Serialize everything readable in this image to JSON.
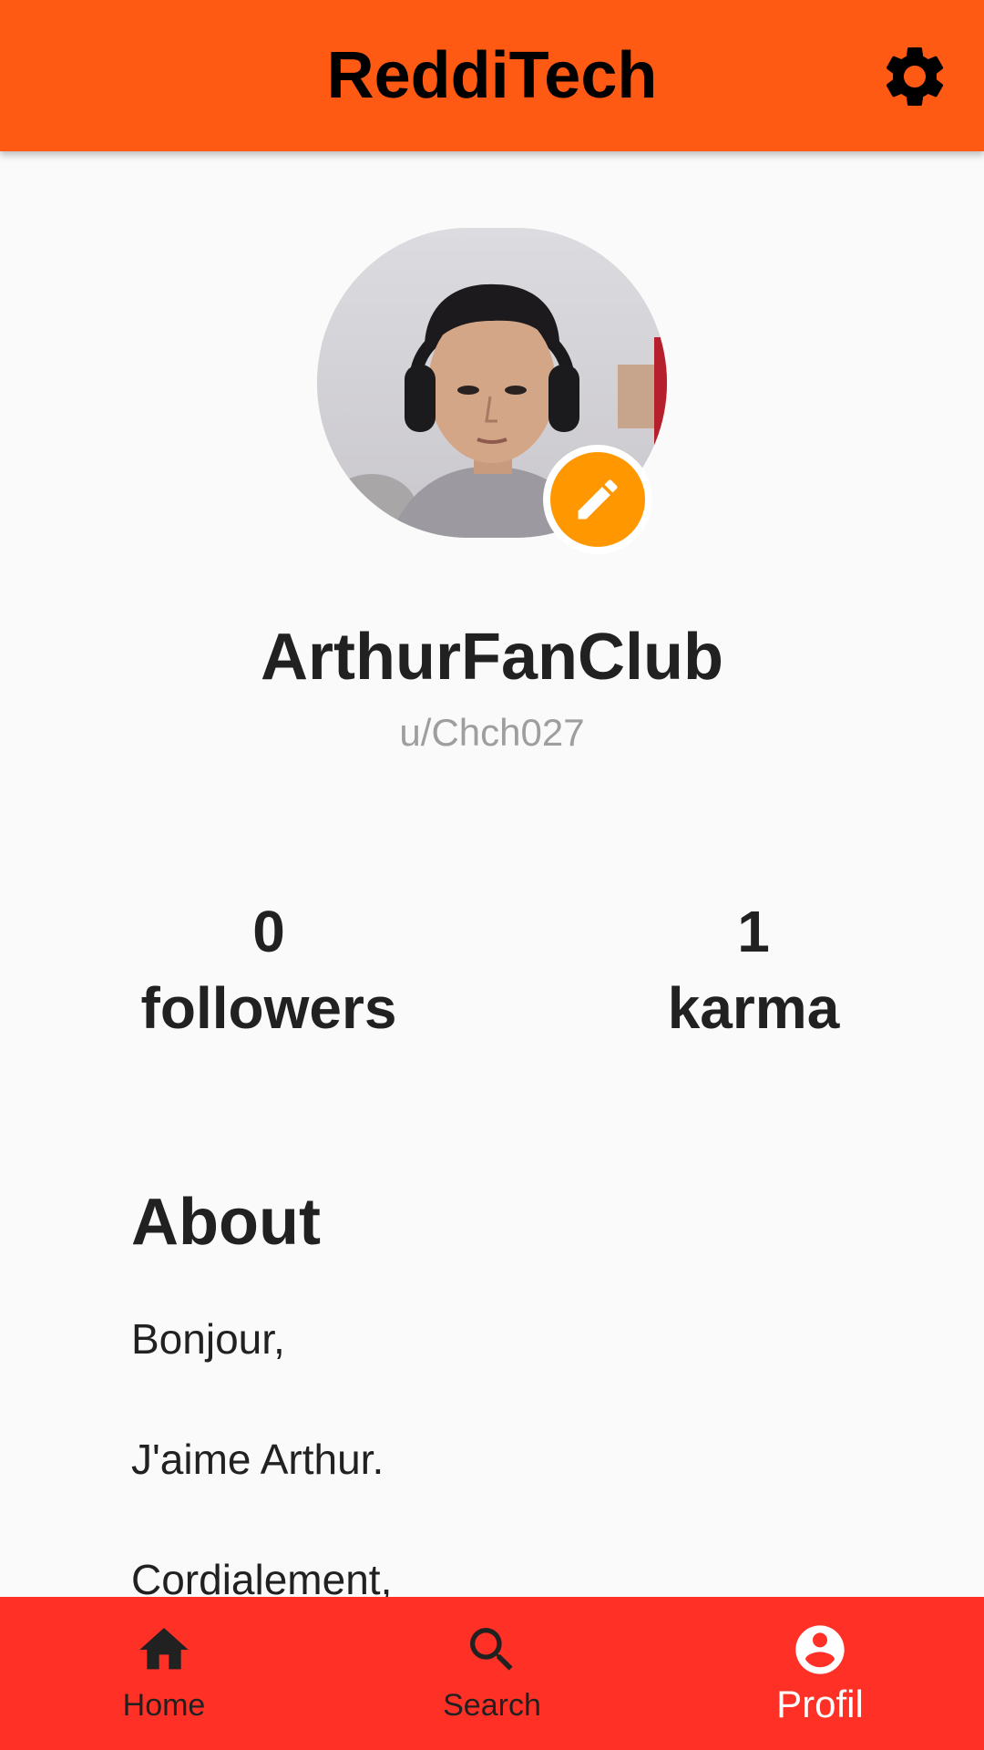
{
  "app_bar": {
    "title": "ReddiTech",
    "settings_icon": "gear-icon",
    "background": "#FF5A14"
  },
  "profile": {
    "avatar_alt": "profile photo",
    "edit_icon": "pencil-icon",
    "edit_color": "#FF9800",
    "display_name": "ArthurFanClub",
    "username": "u/Chch027"
  },
  "stats": {
    "followers": {
      "value": "0",
      "label": "followers"
    },
    "karma": {
      "value": "1",
      "label": "karma"
    }
  },
  "about": {
    "heading": "About",
    "lines": [
      "Bonjour,",
      "J'aime Arthur.",
      "Cordialement,"
    ]
  },
  "bottom_nav": {
    "background": "#FF3126",
    "items": [
      {
        "label": "Home",
        "icon": "home-icon",
        "active": false
      },
      {
        "label": "Search",
        "icon": "search-icon",
        "active": false
      },
      {
        "label": "Profil",
        "icon": "account-circle-icon",
        "active": true
      }
    ]
  }
}
